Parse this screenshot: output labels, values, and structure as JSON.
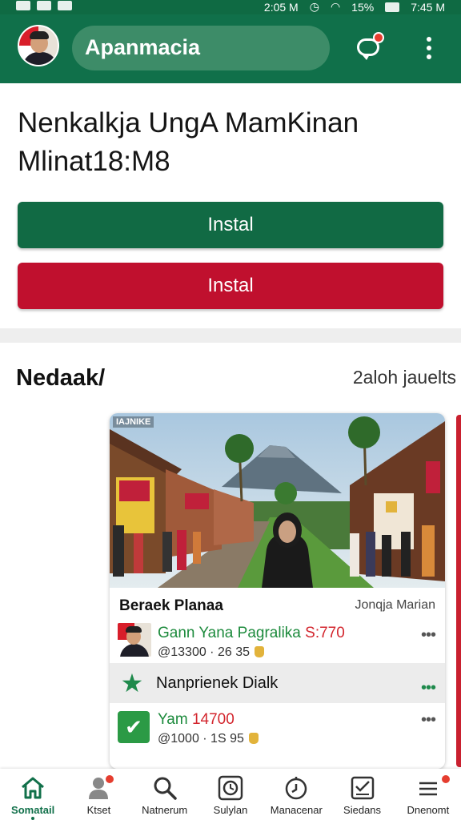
{
  "status_bar": {
    "time": "2:05 M",
    "battery": "15%",
    "clock_right": "7:45 M"
  },
  "app_bar": {
    "title": "Apanmacia"
  },
  "hero": {
    "headline_line1": "Nenkalkja UngA MamKinan",
    "headline_line2": "Mlinat18:M8",
    "install_primary": "Instal",
    "install_secondary": "Instal"
  },
  "section": {
    "title": "Nedaak/",
    "link": "2aloh jauelts",
    "card": {
      "image_tag": "IAJNIKE",
      "title": "Beraek Planaa",
      "author": "Jonqja Marian",
      "rows": [
        {
          "name": "Gann Yana Pagralika",
          "name_accent": "S:770",
          "meta": "@13300 · 26  35",
          "more": "•••"
        },
        {
          "label": "Nanprienek Dialk",
          "more": "•••"
        },
        {
          "name": "Yam",
          "name_accent": "14700",
          "meta": "@1000  · 1S  95",
          "more": "•••"
        }
      ]
    }
  },
  "bottom_nav": [
    {
      "label": "Somatail",
      "icon": "home-icon",
      "active": true
    },
    {
      "label": "Ktset",
      "icon": "person-icon"
    },
    {
      "label": "Natnerum",
      "icon": "search-icon"
    },
    {
      "label": "Sulylan",
      "icon": "clock-icon"
    },
    {
      "label": "Manacenar",
      "icon": "timer-icon"
    },
    {
      "label": "Siedans",
      "icon": "checklist-icon"
    },
    {
      "label": "Dnenomt",
      "icon": "menu-icon"
    }
  ],
  "colors": {
    "primary_green": "#10704a",
    "accent_red": "#c0102e",
    "badge_red": "#e53d2f",
    "link_green": "#1d8b3d"
  }
}
